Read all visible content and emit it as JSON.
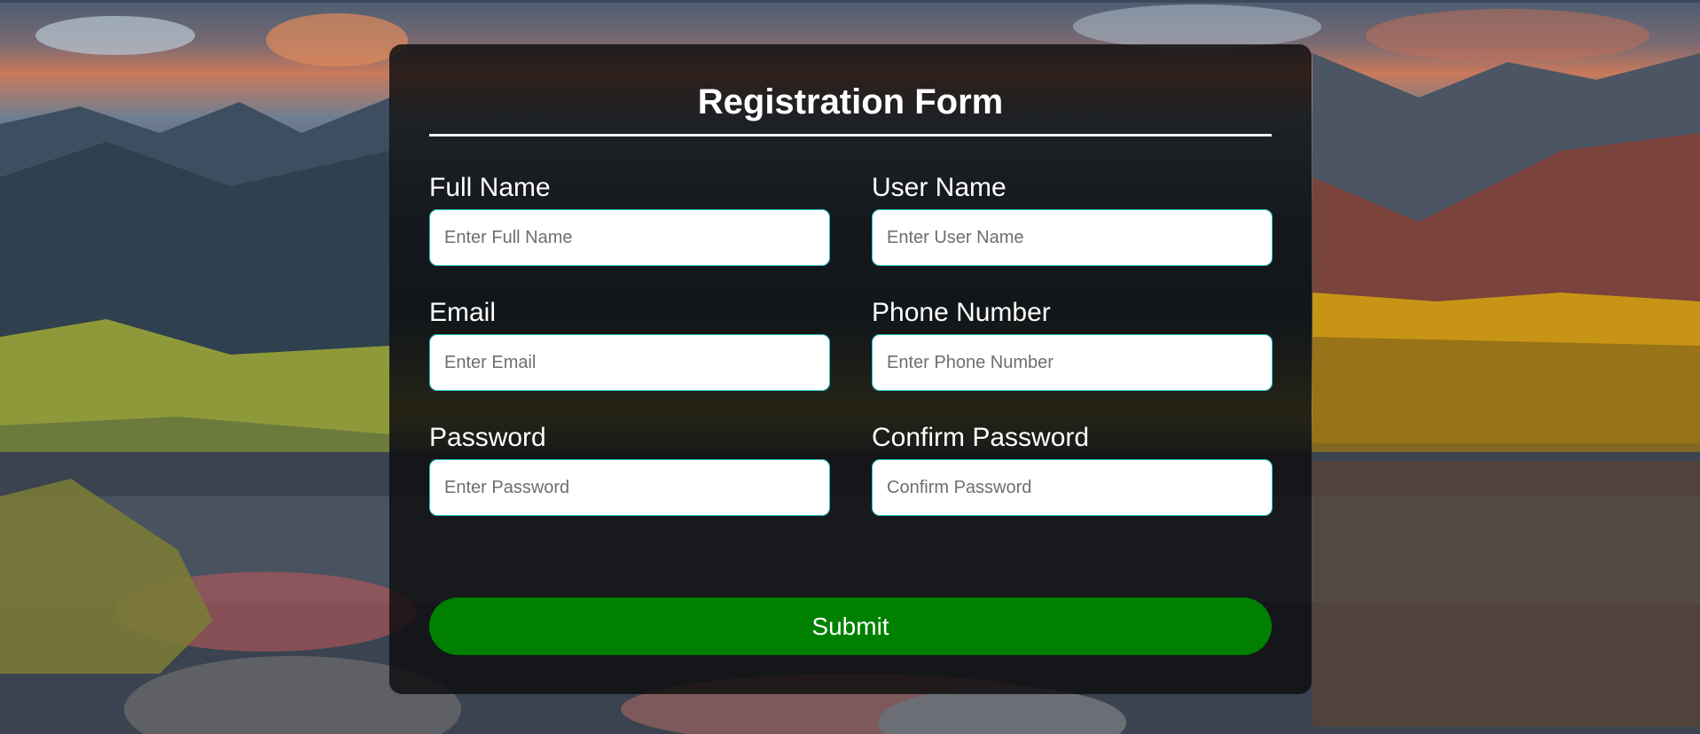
{
  "form": {
    "title": "Registration Form",
    "fields": [
      {
        "label": "Full Name",
        "placeholder": "Enter Full Name"
      },
      {
        "label": "User Name",
        "placeholder": "Enter User Name"
      },
      {
        "label": "Email",
        "placeholder": "Enter Email"
      },
      {
        "label": "Phone Number",
        "placeholder": "Enter Phone Number"
      },
      {
        "label": "Password",
        "placeholder": "Enter Password"
      },
      {
        "label": "Confirm Password",
        "placeholder": "Confirm Password"
      }
    ],
    "submit_label": "Submit"
  },
  "colors": {
    "card_background": "#0c0c0e",
    "submit_button": "#008000",
    "input_border": "#29c7c7",
    "text": "#ffffff"
  }
}
